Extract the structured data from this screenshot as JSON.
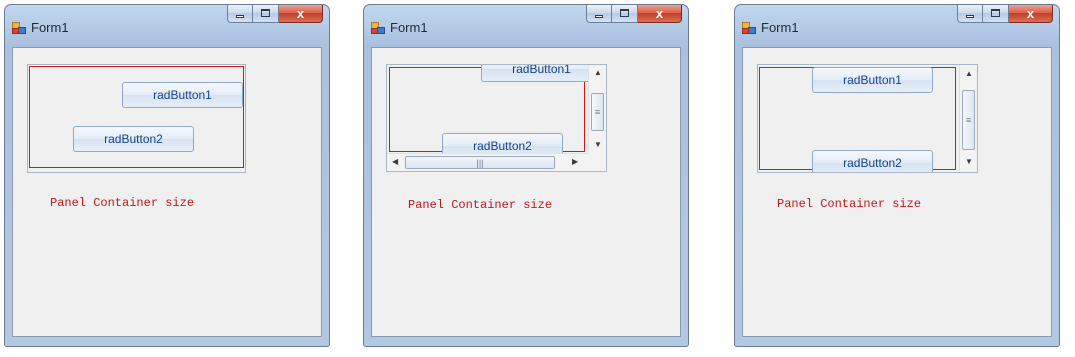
{
  "forms": [
    {
      "title": "Form1",
      "panel_buttons": [
        "radButton1",
        "radButton2"
      ],
      "panel_label": "Panel Container size",
      "scrollbars": "none"
    },
    {
      "title": "Form1",
      "panel_buttons": [
        "radButton1",
        "radButton2"
      ],
      "panel_label": "Panel Container size",
      "scrollbars": "vertical and horizontal",
      "hscroll_thumb_glyph": "|||",
      "vscroll_thumb_glyph": "≡"
    },
    {
      "title": "Form1",
      "panel_buttons": [
        "radButton1",
        "radButton2"
      ],
      "panel_label": "Panel Container size",
      "scrollbars": "vertical",
      "vscroll_thumb_glyph": "≡"
    }
  ],
  "caption_buttons": {
    "minimize": "minimize-icon",
    "maximize": "maximize-icon",
    "close": "x"
  },
  "colors": {
    "outline_red": "#d01818",
    "label_red": "#c01818",
    "button_text": "#15428b"
  }
}
